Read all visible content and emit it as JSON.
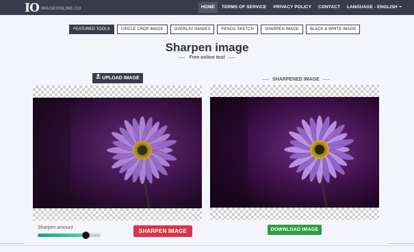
{
  "brand": {
    "mark": "IO",
    "name": "IMAGEONLINE.CO"
  },
  "nav": {
    "items": [
      {
        "label": "HOME"
      },
      {
        "label": "TERMS OF SERVICE"
      },
      {
        "label": "PRIVACY POLICY"
      },
      {
        "label": "CONTACT"
      },
      {
        "label": "LANGUAGE - ENGLISH"
      }
    ]
  },
  "tools": {
    "items": [
      {
        "label": "FEATURED TOOLS"
      },
      {
        "label": "CIRCLE CROP IMAGE"
      },
      {
        "label": "OVERLAY IMAGES"
      },
      {
        "label": "PENCIL SKETCH"
      },
      {
        "label": "SHARPEN IMAGE"
      },
      {
        "label": "BLACK & WHITE IMAGE"
      }
    ]
  },
  "page": {
    "title": "Sharpen image",
    "subtitle": "Free online tool"
  },
  "upload": {
    "label": "UPLOAD IMAGE",
    "icon": "upload-icon"
  },
  "result": {
    "label": "SHARPENED IMAGE"
  },
  "slider": {
    "label": "Sharpen amount",
    "value": 0.8
  },
  "actions": {
    "sharpen_label": "SHARPEN IMAGE",
    "download_label": "DOWNLOAD IMAGE"
  },
  "colors": {
    "navbar": "#3b3b4d",
    "sharpen_button": "#d8354a",
    "download_button": "#2e9d47",
    "slider_start": "#1a9e8a",
    "slider_end": "#45d99b",
    "petal": "#b08ad8",
    "flower_center": "#d4a21a"
  }
}
